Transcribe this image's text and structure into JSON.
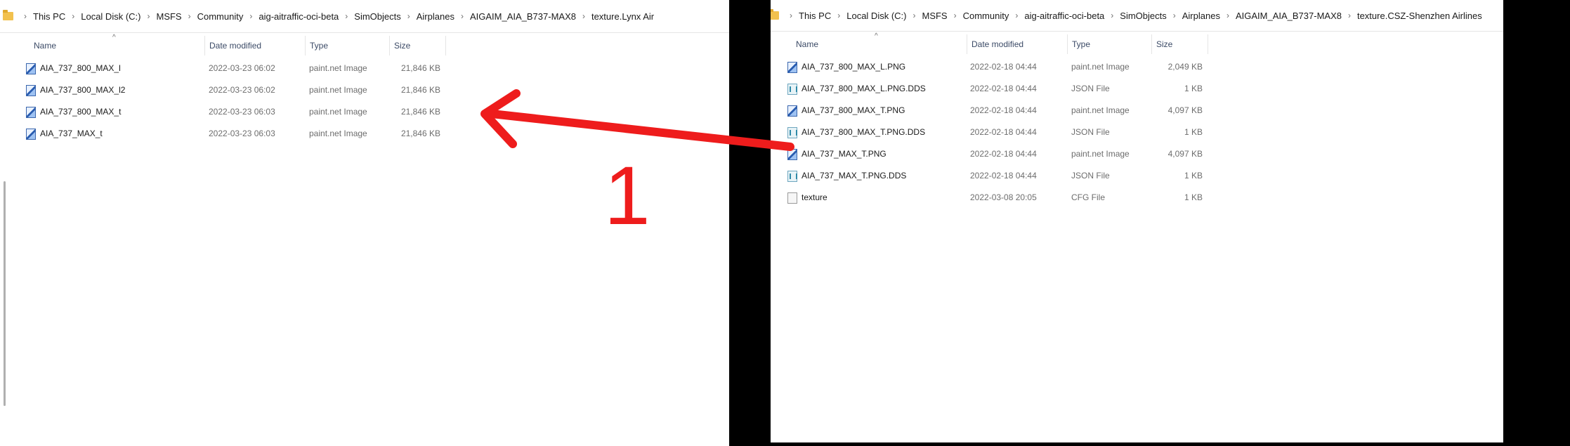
{
  "left_window": {
    "breadcrumb": [
      "This PC",
      "Local Disk (C:)",
      "MSFS",
      "Community",
      "aig-aitraffic-oci-beta",
      "SimObjects",
      "Airplanes",
      "AIGAIM_AIA_B737-MAX8",
      "texture.Lynx Air"
    ],
    "columns": {
      "name": "Name",
      "date": "Date modified",
      "type": "Type",
      "size": "Size"
    },
    "files": [
      {
        "name": "AIA_737_800_MAX_l",
        "date": "2022-03-23 06:02",
        "type": "paint.net Image",
        "size": "21,846 KB",
        "icon": "paintnet-file-icon"
      },
      {
        "name": "AIA_737_800_MAX_l2",
        "date": "2022-03-23 06:02",
        "type": "paint.net Image",
        "size": "21,846 KB",
        "icon": "paintnet-file-icon"
      },
      {
        "name": "AIA_737_800_MAX_t",
        "date": "2022-03-23 06:03",
        "type": "paint.net Image",
        "size": "21,846 KB",
        "icon": "paintnet-file-icon"
      },
      {
        "name": "AIA_737_MAX_t",
        "date": "2022-03-23 06:03",
        "type": "paint.net Image",
        "size": "21,846 KB",
        "icon": "paintnet-file-icon"
      }
    ]
  },
  "right_window": {
    "breadcrumb": [
      "This PC",
      "Local Disk (C:)",
      "MSFS",
      "Community",
      "aig-aitraffic-oci-beta",
      "SimObjects",
      "Airplanes",
      "AIGAIM_AIA_B737-MAX8",
      "texture.CSZ-Shenzhen Airlines"
    ],
    "columns": {
      "name": "Name",
      "date": "Date modified",
      "type": "Type",
      "size": "Size"
    },
    "files": [
      {
        "name": "AIA_737_800_MAX_L.PNG",
        "date": "2022-02-18 04:44",
        "type": "paint.net Image",
        "size": "2,049 KB",
        "icon": "paintnet-file-icon"
      },
      {
        "name": "AIA_737_800_MAX_L.PNG.DDS",
        "date": "2022-02-18 04:44",
        "type": "JSON File",
        "size": "1 KB",
        "icon": "json-file-icon"
      },
      {
        "name": "AIA_737_800_MAX_T.PNG",
        "date": "2022-02-18 04:44",
        "type": "paint.net Image",
        "size": "4,097 KB",
        "icon": "paintnet-file-icon"
      },
      {
        "name": "AIA_737_800_MAX_T.PNG.DDS",
        "date": "2022-02-18 04:44",
        "type": "JSON File",
        "size": "1 KB",
        "icon": "json-file-icon"
      },
      {
        "name": "AIA_737_MAX_T.PNG",
        "date": "2022-02-18 04:44",
        "type": "paint.net Image",
        "size": "4,097 KB",
        "icon": "paintnet-file-icon"
      },
      {
        "name": "AIA_737_MAX_T.PNG.DDS",
        "date": "2022-02-18 04:44",
        "type": "JSON File",
        "size": "1 KB",
        "icon": "json-file-icon"
      },
      {
        "name": "texture",
        "date": "2022-03-08 20:05",
        "type": "CFG File",
        "size": "1 KB",
        "icon": "cfg-file-icon"
      }
    ]
  },
  "annotation": {
    "number": "1",
    "color": "#ee1c1c"
  }
}
